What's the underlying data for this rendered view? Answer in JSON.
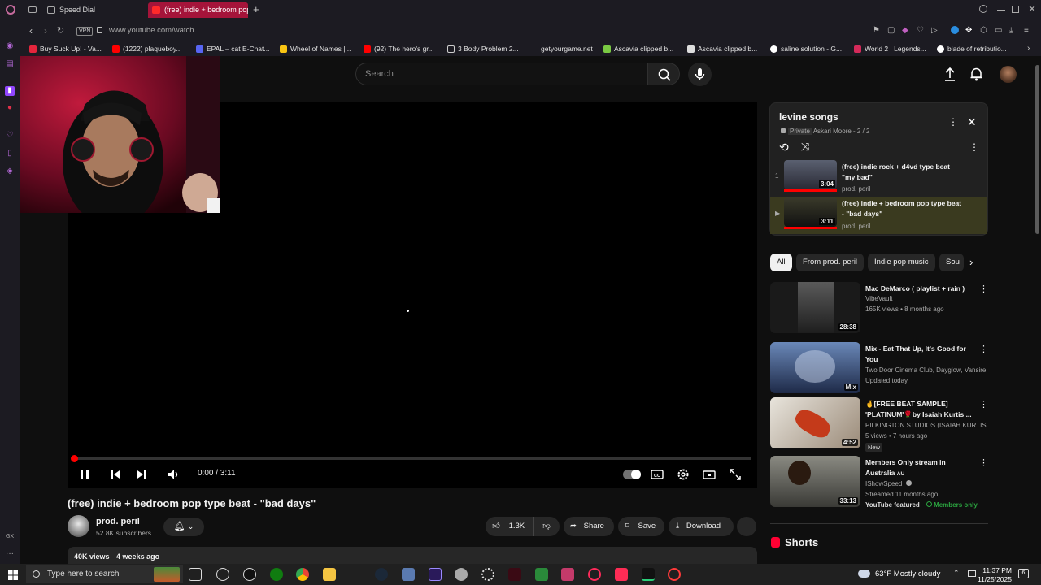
{
  "browser": {
    "tabs": [
      {
        "label": "Speed Dial",
        "active": false
      },
      {
        "label": "(free) indie + bedroom pop type beat - \"bad days\"",
        "active": true
      }
    ],
    "url": "www.youtube.com/watch",
    "vpn_label": "VPN",
    "bookmarks": [
      "Buy Suck Up! - Va...",
      "(1222) plaqueboy...",
      "EPAL – cat E-Chat...",
      "Wheel of Names |...",
      "(92) The hero's gr...",
      "3 Body Problem 2...",
      "getyourgame.net",
      "Ascavia clipped b...",
      "Ascavia clipped b...",
      "saline solution - G...",
      "World 2 | Legends...",
      "blade of retributio..."
    ]
  },
  "youtube": {
    "search_placeholder": "Search",
    "player": {
      "time": "0:00 / 3:11",
      "progress_fraction": 0.0
    },
    "video": {
      "title": "(free) indie + bedroom pop type beat - \"bad days\"",
      "channel": "prod. peril",
      "subscribers": "52.8K subscribers",
      "likes": "1.3K",
      "share_label": "Share",
      "save_label": "Save",
      "download_label": "Download",
      "views": "40K views",
      "age": "4 weeks ago"
    },
    "playlist": {
      "title": "levine songs",
      "privacy": "Private",
      "owner_info": "Askari Moore - 2 / 2",
      "items": [
        {
          "index": "1",
          "title": "(free) indie rock + d4vd type beat \"my bad\"",
          "channel": "prod. peril",
          "duration": "3:04"
        },
        {
          "index": "▶",
          "title": "(free) indie + bedroom pop type beat - \"bad days\"",
          "channel": "prod. peril",
          "duration": "3:11"
        }
      ]
    },
    "chips": [
      "All",
      "From prod. peril",
      "Indie pop music",
      "Sou"
    ],
    "recommendations": [
      {
        "title": "Mac DeMarco ( playlist + rain )",
        "channel": "VibeVault",
        "meta": "165K views • 8 months ago",
        "duration": "28:38"
      },
      {
        "title": "Mix - Eat That Up, It's Good for You",
        "channel": "Two Door Cinema Club, Dayglow, Vansire...",
        "meta": "Updated today",
        "duration": "Mix"
      },
      {
        "title": "🤞[FREE BEAT SAMPLE] 'PLATINUM'🌹by Isaiah Kurtis ...",
        "channel": "PILKINGTON STUDIOS (ISAIAH KURTIS ...",
        "meta": "5 views • 7 hours ago",
        "duration": "4:52",
        "badge": "New"
      },
      {
        "title": "Members Only stream in Australia",
        "title_suffix": "AU",
        "channel": "IShowSpeed",
        "meta": "Streamed 11 months ago",
        "duration": "33:13",
        "tag1": "YouTube featured",
        "tag2": "Members only"
      }
    ],
    "shorts_label": "Shorts"
  },
  "taskbar": {
    "search_placeholder": "Type here to search",
    "weather": "63°F  Mostly cloudy",
    "time": "11:37 PM",
    "date": "11/25/2025"
  }
}
